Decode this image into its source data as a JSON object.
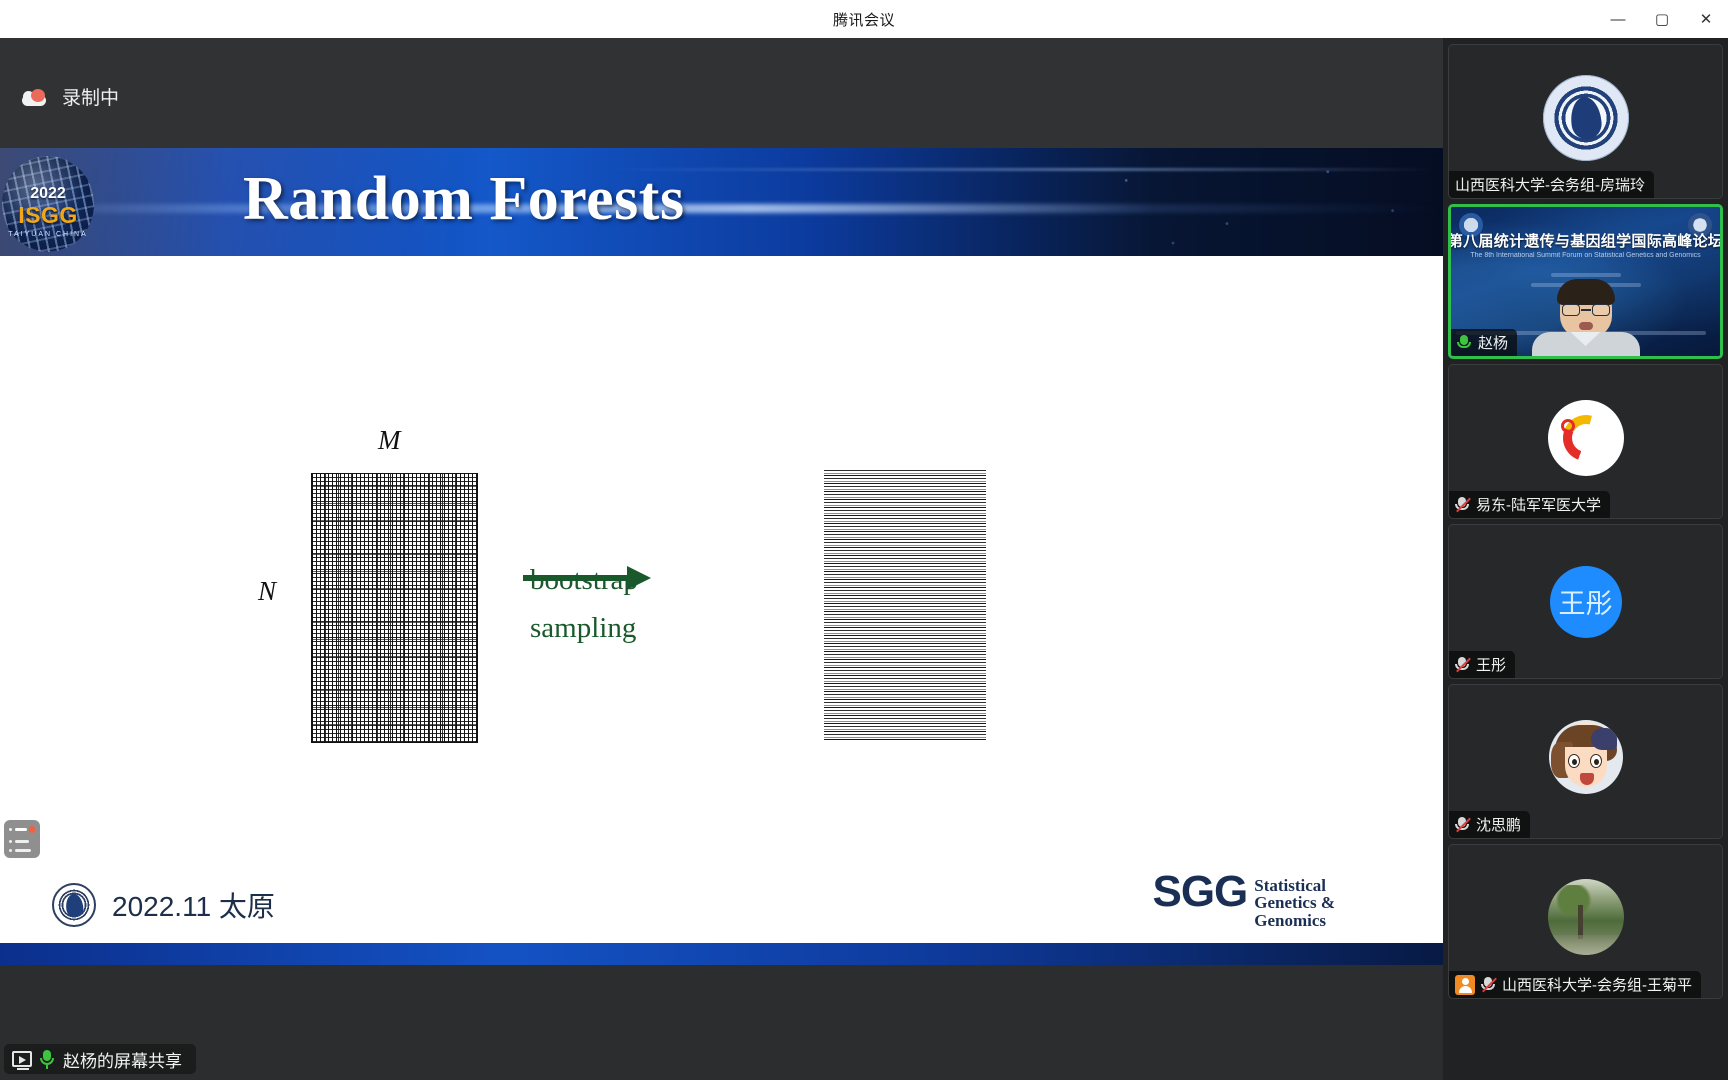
{
  "window": {
    "title": "腾讯会议",
    "minimize_label": "—",
    "maximize_label": "▢",
    "close_label": "✕"
  },
  "recording": {
    "label": "录制中",
    "icon": "cloud-record-icon"
  },
  "slide": {
    "title": "Random Forests",
    "logo": {
      "year": "2022",
      "name": "ISGG",
      "sub": "TAIYUAN  CHINA"
    },
    "diagram": {
      "label_columns": "M",
      "label_rows": "N",
      "arrow_label_top": "bootstrap",
      "arrow_label_bottom": "sampling",
      "arrow_color": "#19592b"
    },
    "footer": {
      "date_place": "2022.11 太原",
      "sgg_mark": "SGG",
      "sgg_line1": "Statistical",
      "sgg_line2": "Genetics &",
      "sgg_line3": "Genomics"
    }
  },
  "share_label": {
    "text": "赵杨的屏幕共享",
    "share_icon": "screen-share-icon",
    "mic_icon": "mic-on-icon"
  },
  "participants": [
    {
      "name": "山西医科大学-会务组-房瑞玲",
      "avatar_type": "seal",
      "mic": "none",
      "speaking": false,
      "host": false
    },
    {
      "name": "赵杨",
      "avatar_type": "video",
      "mic": "on",
      "speaking": true,
      "host": false,
      "virtual_background": {
        "title": "第八届统计遗传与基因组学国际高峰论坛",
        "subtitle": "The 8th International Summit Forum on Statistical Genetics and Genomics"
      }
    },
    {
      "name": "易东-陆军军医大学",
      "avatar_type": "heart",
      "mic": "muted",
      "speaking": false,
      "host": false
    },
    {
      "name": "王彤",
      "avatar_type": "initials",
      "initials": "王彤",
      "avatar_color": "#1e8cff",
      "mic": "muted",
      "speaking": false,
      "host": false
    },
    {
      "name": "沈思鹏",
      "avatar_type": "anime",
      "mic": "muted",
      "speaking": false,
      "host": false
    },
    {
      "name": "山西医科大学-会务组-王菊平",
      "avatar_type": "scene",
      "mic": "muted",
      "speaking": false,
      "host": true
    }
  ]
}
